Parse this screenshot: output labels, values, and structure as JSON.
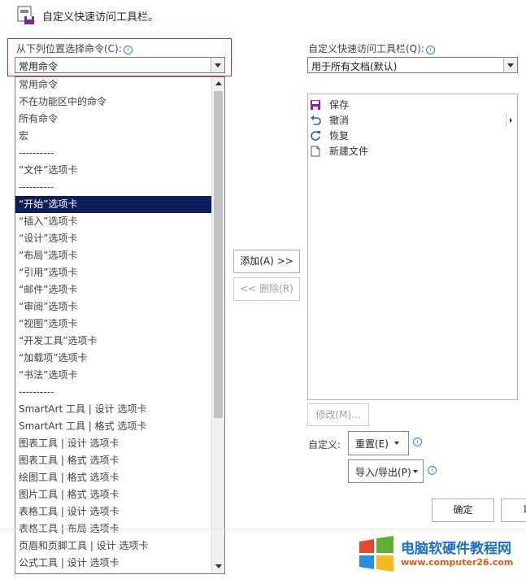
{
  "header": {
    "title": "自定义快速访问工具栏。"
  },
  "left": {
    "label": "从下列位置选择命令(C):",
    "combo_value": "常用命令",
    "items": [
      "常用命令",
      "不在功能区中的命令",
      "所有命令",
      "宏",
      "----------",
      "“文件”选项卡",
      "----------",
      "“开始”选项卡",
      "“插入”选项卡",
      "“设计”选项卡",
      "“布局”选项卡",
      "“引用”选项卡",
      "“邮件”选项卡",
      "“审阅”选项卡",
      "“视图”选项卡",
      "“开发工具”选项卡",
      "“加载项”选项卡",
      "“书法”选项卡",
      "----------",
      "SmartArt 工具 | 设计 选项卡",
      "SmartArt 工具 | 格式 选项卡",
      "图表工具 | 设计 选项卡",
      "图表工具 | 格式 选项卡",
      "绘图工具 | 格式 选项卡",
      "图片工具 | 格式 选项卡",
      "表格工具 | 设计 选项卡",
      "表格工具 | 布局 选项卡",
      "页眉和页脚工具 | 设计 选项卡",
      "公式工具 | 设计 选项卡"
    ],
    "selected_index": 7
  },
  "middle": {
    "add_label": "添加(A) >>",
    "remove_label": "<< 删除(R)"
  },
  "right": {
    "label": "自定义快速访问工具栏(Q):",
    "combo_value": "用于所有文档(默认)",
    "items": [
      {
        "label": "保存",
        "icon": "save-icon"
      },
      {
        "label": "撤消",
        "icon": "undo-icon"
      },
      {
        "label": "恢复",
        "icon": "redo-icon"
      },
      {
        "label": "新建文件",
        "icon": "new-file-icon"
      }
    ],
    "modify_label": "修改(M)...",
    "customize_label": "自定义:",
    "reset_label": "重置(E)",
    "import_export_label": "导入/导出(P)"
  },
  "footer": {
    "ok_label": "确定",
    "cancel_label_partial": "取"
  },
  "watermark": {
    "title": "电脑软硬件教程网",
    "url": "www.computer26.com"
  },
  "colors": {
    "selection": "#0e1e5c",
    "highlight_border": "#d22a2a",
    "accent": "#3b7fd6"
  }
}
